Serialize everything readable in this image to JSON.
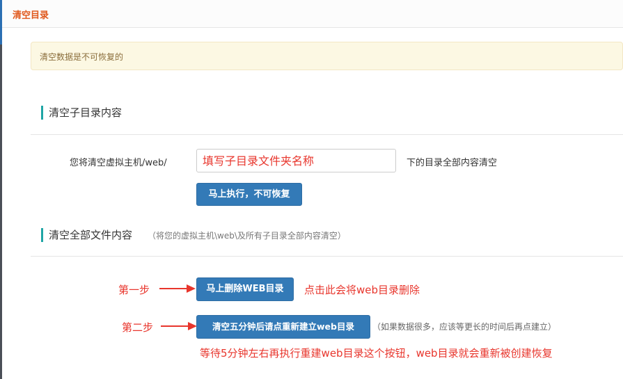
{
  "tab": {
    "title": "清空目录"
  },
  "alert": {
    "text": "清空数据是不可恢复的"
  },
  "subdir_section": {
    "title": "清空子目录内容",
    "prefix_label": "您将清空虚拟主机/web/",
    "input_placeholder": "填写子目录文件夹名称",
    "input_value": "",
    "suffix_label": "下的目录全部内容清空",
    "execute_button": "马上执行，不可恢复"
  },
  "all_section": {
    "title": "清空全部文件内容",
    "hint": "（将您的虚拟主机\\web\\及所有子目录全部内容清空）",
    "step1_label": "第一步",
    "delete_button": "马上删除WEB目录",
    "step1_note": "点击此会将web目录删除",
    "step2_label": "第二步",
    "rebuild_button": "清空五分钟后请点重新建立web目录",
    "rebuild_hint": "（如果数据很多，应该等更长的时间后再点建立）",
    "step2_note": "等待5分钟左右再执行重建web目录这个按钮，web目录就会重新被创建恢复"
  },
  "colors": {
    "accent": "#e0581c",
    "primary": "#337ab7",
    "annotation": "#e8352c",
    "teal": "#1fa5a5"
  }
}
